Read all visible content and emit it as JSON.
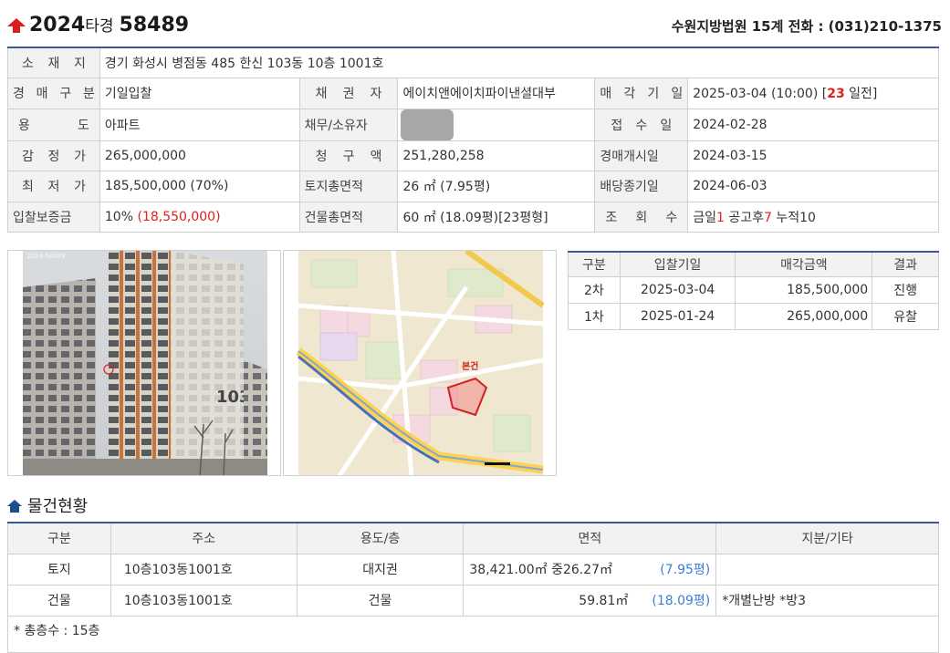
{
  "header": {
    "case_year": "2024",
    "case_kind": "타경",
    "case_number": "58489",
    "court_info": "수원지방법원 15계 전화 : (031)210-1375"
  },
  "info": {
    "location_label": "소재지",
    "location_value": "경기 화성시 병점동 485 한신 103동 10층 1001호",
    "auction_type_label": "경매구분",
    "auction_type_value": "기일입찰",
    "creditor_label": "채권자",
    "creditor_value": "에이치앤에이치파이낸셜대부",
    "sale_date_label": "매각기일",
    "sale_date_value": "2025-03-04 (10:00) [",
    "sale_date_days": "23",
    "sale_date_suffix": " 일전]",
    "use_label": "용도",
    "use_value": "아파트",
    "debtor_label": "채무/소유자",
    "receipt_label": "접수일",
    "receipt_value": "2024-02-28",
    "appraisal_label": "감정가",
    "appraisal_value": "265,000,000",
    "claim_label": "청구액",
    "claim_value": "251,280,258",
    "start_label": "경매개시일",
    "start_value": "2024-03-15",
    "min_price_label": "최저가",
    "min_price_value": "185,500,000 (70%)",
    "land_area_label": "토지총면적",
    "land_area_value": "26 ㎡ (7.95평)",
    "dividend_label": "배당종기일",
    "dividend_value": "2024-06-03",
    "deposit_label": "입찰보증금",
    "deposit_pct": "10% ",
    "deposit_amount": "(18,550,000)",
    "building_area_label": "건물총면적",
    "building_area_value": "60 ㎡ (18.09평)[23평형]",
    "views_label": "조회수",
    "views_today_label": "금일",
    "views_today": "1",
    "views_after_label": " 공고후",
    "views_after": "7",
    "views_total_label": " 누적",
    "views_total": "10"
  },
  "photo": {
    "watermark": "2024-58489",
    "building_number": "103",
    "map_label": "본건"
  },
  "history": {
    "headers": [
      "구분",
      "입찰기일",
      "매각금액",
      "결과"
    ],
    "rows": [
      {
        "round": "2차",
        "date": "2025-03-04",
        "price": "185,500,000",
        "result": "진행"
      },
      {
        "round": "1차",
        "date": "2025-01-24",
        "price": "265,000,000",
        "result": "유찰"
      }
    ]
  },
  "property": {
    "section_title": "물건현황",
    "headers": [
      "구분",
      "주소",
      "용도/층",
      "면적",
      "지분/기타"
    ],
    "rows": [
      {
        "type": "토지",
        "address": "10층103동1001호",
        "use": "대지권",
        "area": "38,421.00㎡ 중26.27㎡",
        "pyeong": "(7.95평)",
        "etc": ""
      },
      {
        "type": "건물",
        "address": "10층103동1001호",
        "use": "건물",
        "area": "59.81㎡",
        "pyeong": "(18.09평)",
        "etc": "*개별난방 *방3"
      }
    ],
    "footnote": "* 총층수 : 15층"
  },
  "colors": {
    "accent_red": "#e0201a",
    "header_blue": "#385a8c",
    "link_blue": "#3a7fd5"
  }
}
